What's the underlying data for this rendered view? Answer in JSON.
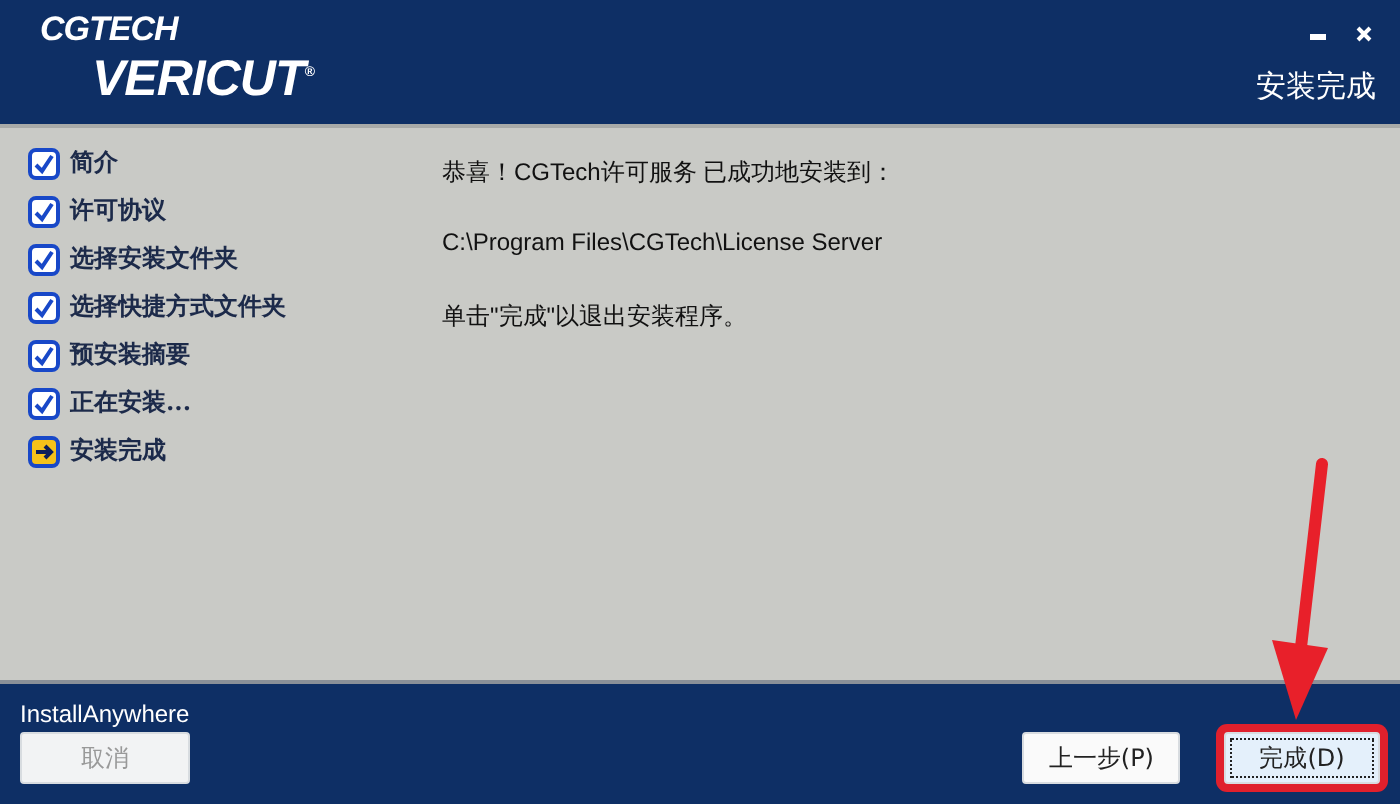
{
  "logo": {
    "top": "CGTECH",
    "bottom": "VERICUT",
    "mark": "®"
  },
  "window_controls": [
    {
      "kind": "minimize"
    },
    {
      "kind": "close"
    }
  ],
  "page_title": "安装完成",
  "steps": [
    {
      "label": "简介",
      "kind": "done"
    },
    {
      "label": "许可协议",
      "kind": "done"
    },
    {
      "label": "选择安装文件夹",
      "kind": "done"
    },
    {
      "label": "选择快捷方式文件夹",
      "kind": "done"
    },
    {
      "label": "预安装摘要",
      "kind": "done"
    },
    {
      "label": "正在安装...",
      "kind": "done"
    },
    {
      "label": "安装完成",
      "kind": "current"
    }
  ],
  "messages": [
    "恭喜！CGTech许可服务 已成功地安装到：",
    "C:\\Program Files\\CGTech\\License Server",
    "单击\"完成\"以退出安装程序。"
  ],
  "brand": "InstallAnywhere",
  "cancel_button": {
    "label": "取消",
    "disabled": true
  },
  "buttons": [
    {
      "label": "上一步(P)",
      "disabled": false,
      "focused": false,
      "highlighted": false
    },
    {
      "label": "完成(D)",
      "disabled": false,
      "focused": true,
      "highlighted": true
    }
  ]
}
